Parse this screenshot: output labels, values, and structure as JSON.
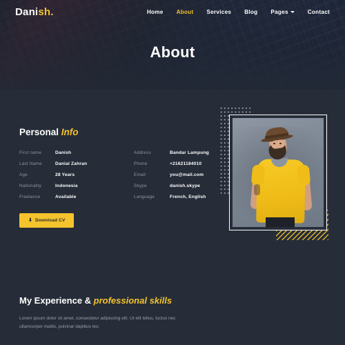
{
  "brand": {
    "name_primary": "Dani",
    "name_accent": "sh."
  },
  "nav": {
    "items": [
      {
        "label": "Home",
        "active": false,
        "has_caret": false
      },
      {
        "label": "About",
        "active": true,
        "has_caret": false
      },
      {
        "label": "Services",
        "active": false,
        "has_caret": false
      },
      {
        "label": "Blog",
        "active": false,
        "has_caret": false
      },
      {
        "label": "Pages",
        "active": false,
        "has_caret": true
      },
      {
        "label": "Contact",
        "active": false,
        "has_caret": false
      }
    ]
  },
  "hero": {
    "title": "About"
  },
  "about": {
    "heading_primary": "Personal ",
    "heading_accent": "Info",
    "left_column": [
      {
        "label": "First name",
        "value": "Danish"
      },
      {
        "label": "Last Name",
        "value": "Danial Zahran"
      },
      {
        "label": "Age",
        "value": "28 Years"
      },
      {
        "label": "Nationality",
        "value": "Indonesia"
      },
      {
        "label": "Freelance",
        "value": "Available"
      }
    ],
    "right_column": [
      {
        "label": "Address",
        "value": "Bandar Lampung"
      },
      {
        "label": "Phone",
        "value": "+21621184010"
      },
      {
        "label": "Email",
        "value": "you@mail.com"
      },
      {
        "label": "Skype",
        "value": "danish.skype"
      },
      {
        "label": "Language",
        "value": "French, English"
      }
    ],
    "download_button": {
      "label": "Download CV",
      "icon": "download-icon",
      "glyph": "⬇"
    }
  },
  "experience": {
    "heading_primary": "My Experience & ",
    "heading_accent": "professional skills",
    "paragraph": "Lorem ipsum dolor sit amet, consectetur adipiscing elit. Ut elit tellus, luctus nec ullamcorper mattis, pulvinar dapibus leo."
  },
  "photo": {
    "alt": "portrait of bearded man wearing yellow t-shirt and brown hat"
  },
  "colors": {
    "accent": "#f5c32c",
    "background": "#262d38",
    "header_background": "#1e2430",
    "muted_text": "#8f95a1"
  }
}
